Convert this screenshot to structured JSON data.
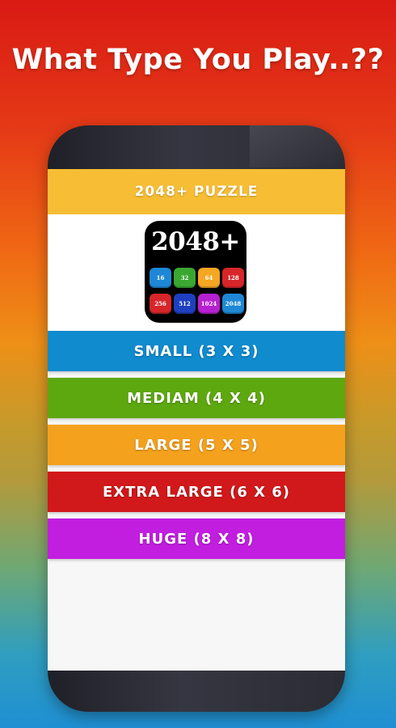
{
  "headline": "What Type You Play..??",
  "app": {
    "title": "2048+ PUZZLE",
    "icon": {
      "title": "2048+",
      "tiles": [
        {
          "value": "16",
          "color": "#1e88d6"
        },
        {
          "value": "32",
          "color": "#3aa830"
        },
        {
          "value": "64",
          "color": "#f5a623"
        },
        {
          "value": "128",
          "color": "#d7262a"
        },
        {
          "value": "256",
          "color": "#d7262a"
        },
        {
          "value": "512",
          "color": "#1e3fc0"
        },
        {
          "value": "1024",
          "color": "#b620d0"
        },
        {
          "value": "2048",
          "color": "#1e88d6"
        }
      ]
    }
  },
  "levels": [
    {
      "label": "SMALL (3 X 3)",
      "color": "#0f8bce"
    },
    {
      "label": "MEDIAM (4 X 4)",
      "color": "#5ea80f"
    },
    {
      "label": "LARGE (5 X 5)",
      "color": "#f4a11d"
    },
    {
      "label": "EXTRA LARGE (6 X 6)",
      "color": "#d1181b"
    },
    {
      "label": "HUGE (8 X 8)",
      "color": "#c21ee0"
    }
  ],
  "colors": {
    "title_bar": "#f7be35",
    "phone_body": "#2b2c34"
  }
}
